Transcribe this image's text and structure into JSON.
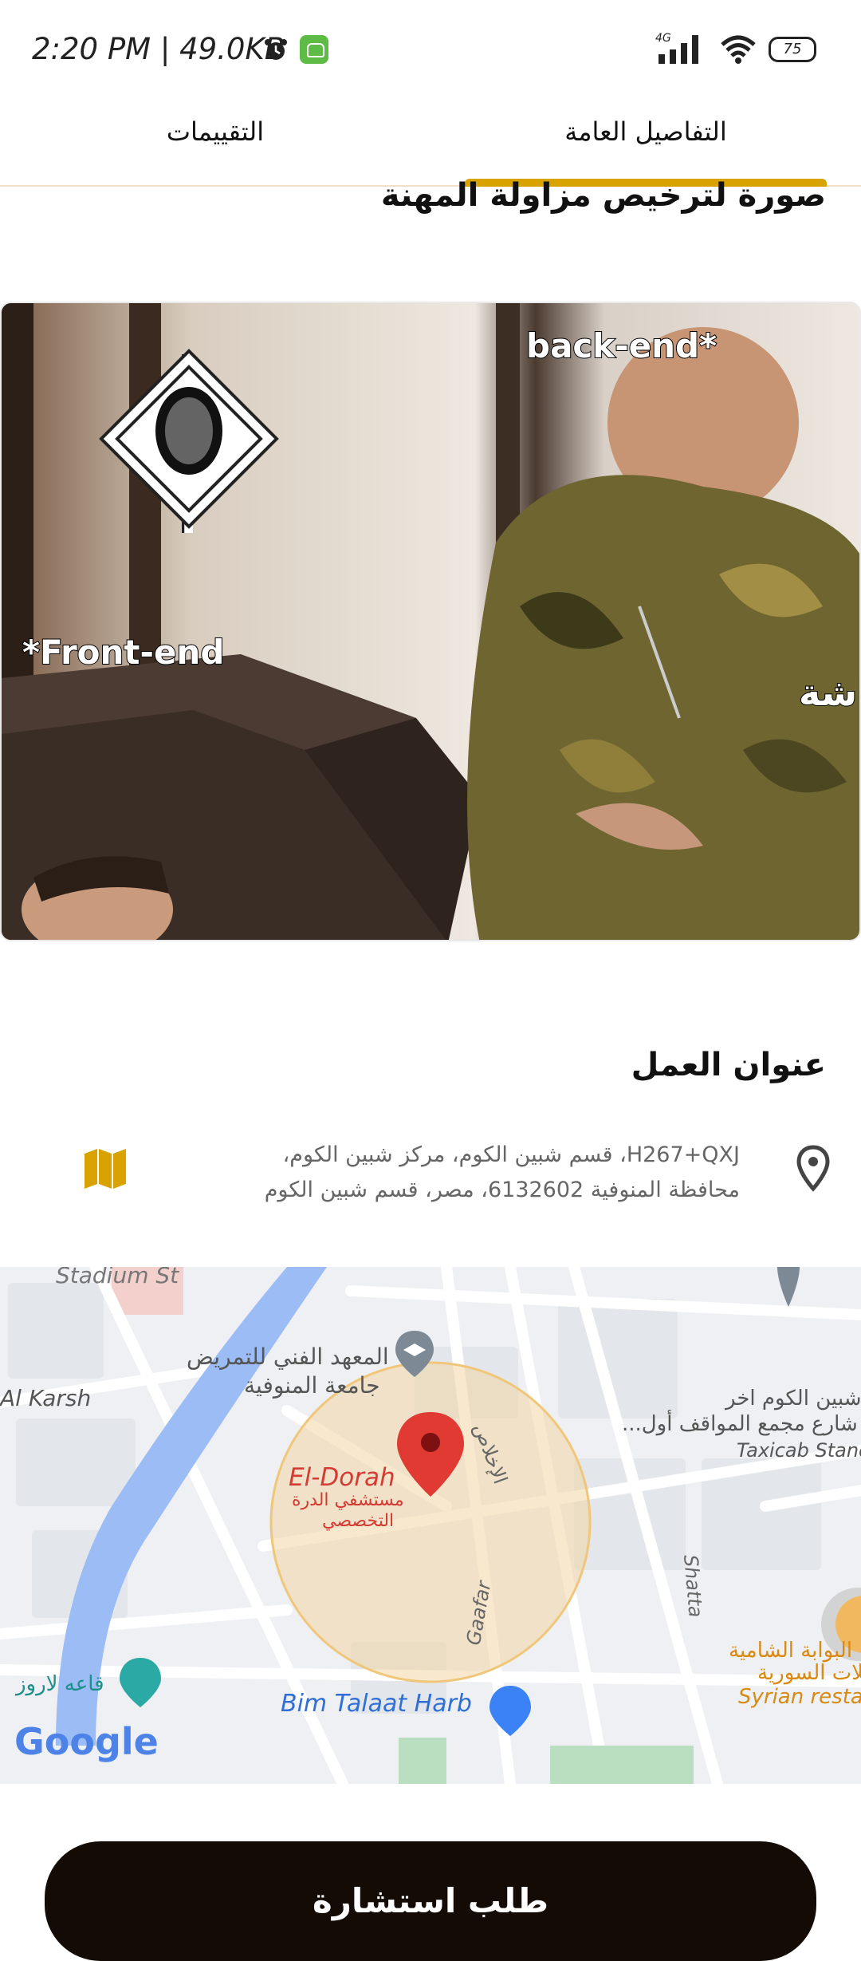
{
  "status_bar": {
    "time": "2:20 PM | 49.0KB",
    "network": "4G",
    "battery": "75"
  },
  "tabs": {
    "details": "التفاصيل العامة",
    "ratings": "التقييمات"
  },
  "license_section": {
    "title": "صورة لترخيص مزاولة المهنة",
    "meme_caption_top": "back-end*",
    "meme_caption_left": "*Front-end",
    "meme_caption_bottom": "خد ال token وعلى ورشة النقاشة"
  },
  "work_address": {
    "title": "عنوان العمل",
    "address_line1": "H267+QXJ، قسم شبين الكوم، مركز شبين الكوم،",
    "address_line2": "محافظة المنوفية 6132602، مصر، قسم شبين الكوم"
  },
  "map": {
    "labels": {
      "stadium": "Stadium St",
      "al_karsh": "Al Karsh",
      "institute_1": "المعهد الفني للتمريض",
      "institute_2": "جامعة المنوفية",
      "el_dorah": "El-Dorah",
      "hospital_1": "مستشفي الدرة",
      "hospital_2": "التخصصي",
      "ikhlas": "الإخلاص",
      "shibin_1": "شبين الكوم اخر",
      "shibin_2": "شارع مجمع المواقف أول...",
      "taxicab": "Taxicab Stand",
      "gaafar": "Gaafar",
      "shatta": "Shatta",
      "shamia_1": "البوابة الشامية",
      "shamia_2": "بلات السورية",
      "syrian": "Syrian resta",
      "laroz": "قاعه لاروز",
      "bim": "Bim Talaat Harb",
      "google": "Google"
    }
  },
  "cta": {
    "label": "طلب استشارة"
  },
  "colors": {
    "accent": "#d8a300",
    "button": "#130b04"
  }
}
